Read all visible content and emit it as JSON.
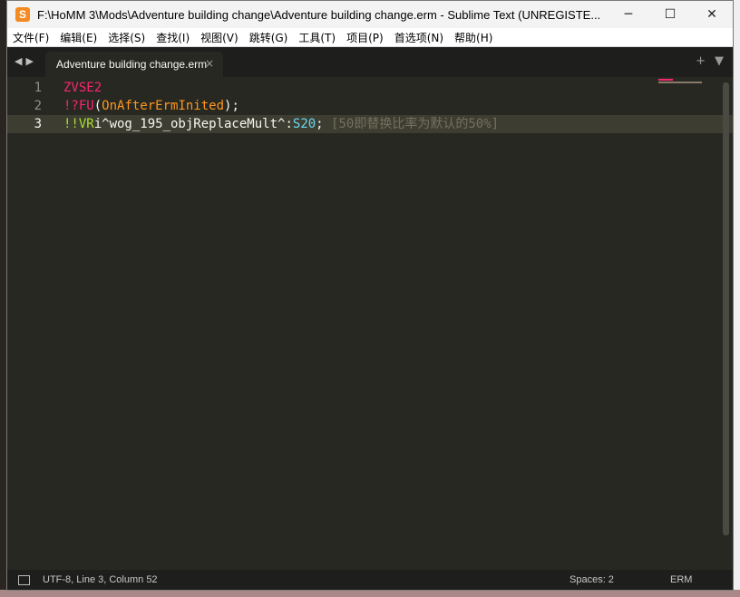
{
  "window": {
    "title": "F:\\HoMM 3\\Mods\\Adventure building change\\Adventure building change.erm - Sublime Text (UNREGISTE...",
    "icon_letter": "S",
    "controls": {
      "minimize": "─",
      "maximize": "☐",
      "close": "✕"
    }
  },
  "menu": [
    "文件(F)",
    "编辑(E)",
    "选择(S)",
    "查找(I)",
    "视图(V)",
    "跳转(G)",
    "工具(T)",
    "项目(P)",
    "首选项(N)",
    "帮助(H)"
  ],
  "tabs": {
    "nav_left": "◀",
    "nav_right": "▶",
    "active_tab": {
      "label": "Adventure building change.erm",
      "close": "×"
    },
    "new_tab": "+",
    "tab_menu": "▼"
  },
  "editor": {
    "line_numbers": [
      "1",
      "2",
      "3"
    ],
    "line1": {
      "text": "ZVSE2"
    },
    "line2": {
      "bang": "!?",
      "fu": "FU",
      "paren_open": "(",
      "arg": "OnAfterErmInited",
      "paren_close": ")",
      "semi": ";"
    },
    "line3": {
      "bang": "!!",
      "vr": "VR",
      "var": "i^wog_195_objReplaceMult^",
      "colon": ":",
      "s": "S",
      "num": "20",
      "semi": ";",
      "space": " ",
      "comment": "[50即替换比率为默认的50%]"
    }
  },
  "status": {
    "position": "UTF-8, Line 3, Column 52",
    "spaces": "Spaces: 2",
    "syntax": "ERM"
  },
  "colors": {
    "background": "#272822",
    "keyword": "#f92672",
    "function": "#a6e22e",
    "argument": "#fd971f",
    "constant": "#66d9ef",
    "comment": "#75715e"
  }
}
